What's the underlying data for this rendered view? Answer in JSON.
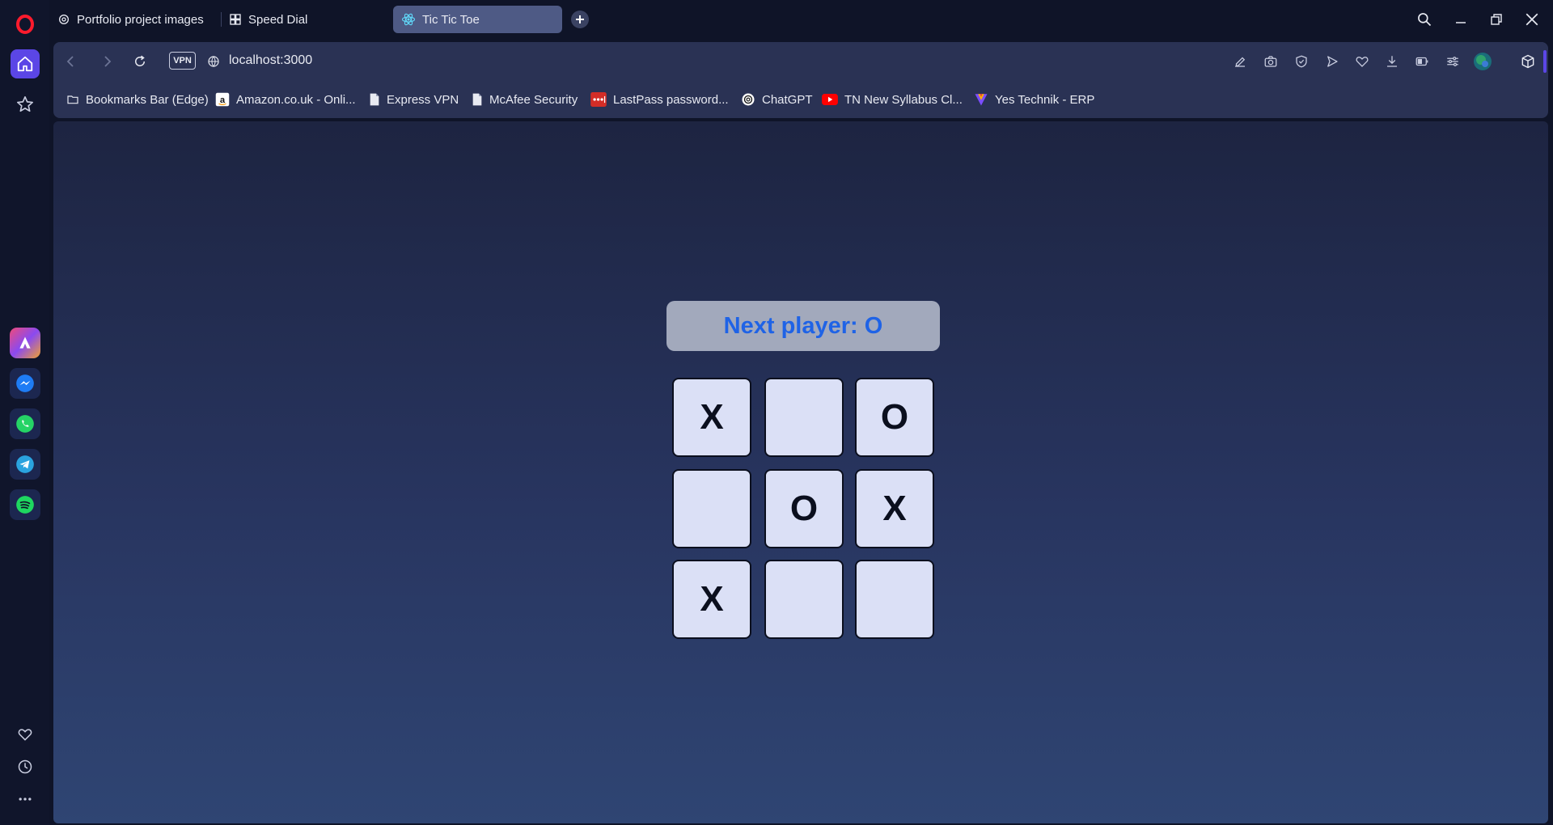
{
  "browser": {
    "tabs": [
      {
        "title": "Portfolio project images",
        "icon": "chatgpt-icon"
      },
      {
        "title": "Speed Dial",
        "icon": "grid-icon"
      },
      {
        "title": "Tic Tic Toe",
        "icon": "react-icon",
        "active": true
      }
    ],
    "url": "localhost:3000",
    "vpn_label": "VPN",
    "bookmarks": [
      {
        "label": "Bookmarks Bar (Edge)",
        "icon": "folder-icon"
      },
      {
        "label": "Amazon.co.uk - Onli...",
        "icon": "amazon-icon"
      },
      {
        "label": "Express VPN",
        "icon": "page-icon"
      },
      {
        "label": "McAfee Security",
        "icon": "page-icon"
      },
      {
        "label": "LastPass password...",
        "icon": "lastpass-icon"
      },
      {
        "label": "ChatGPT",
        "icon": "chatgpt-icon"
      },
      {
        "label": "TN New Syllabus Cl...",
        "icon": "youtube-icon"
      },
      {
        "label": "Yes Technik - ERP",
        "icon": "vuetify-icon"
      }
    ],
    "sidebar_apps": [
      "aria-icon",
      "messenger-icon",
      "whatsapp-icon",
      "telegram-icon",
      "spotify-icon"
    ],
    "colors": {
      "accent": "#5b46e6",
      "status_text": "#1f63e6",
      "cell_bg": "#dbe0f6"
    }
  },
  "game": {
    "status": "Next player: O",
    "board": [
      "X",
      "",
      "O",
      "",
      "O",
      "X",
      "X",
      "",
      ""
    ]
  }
}
